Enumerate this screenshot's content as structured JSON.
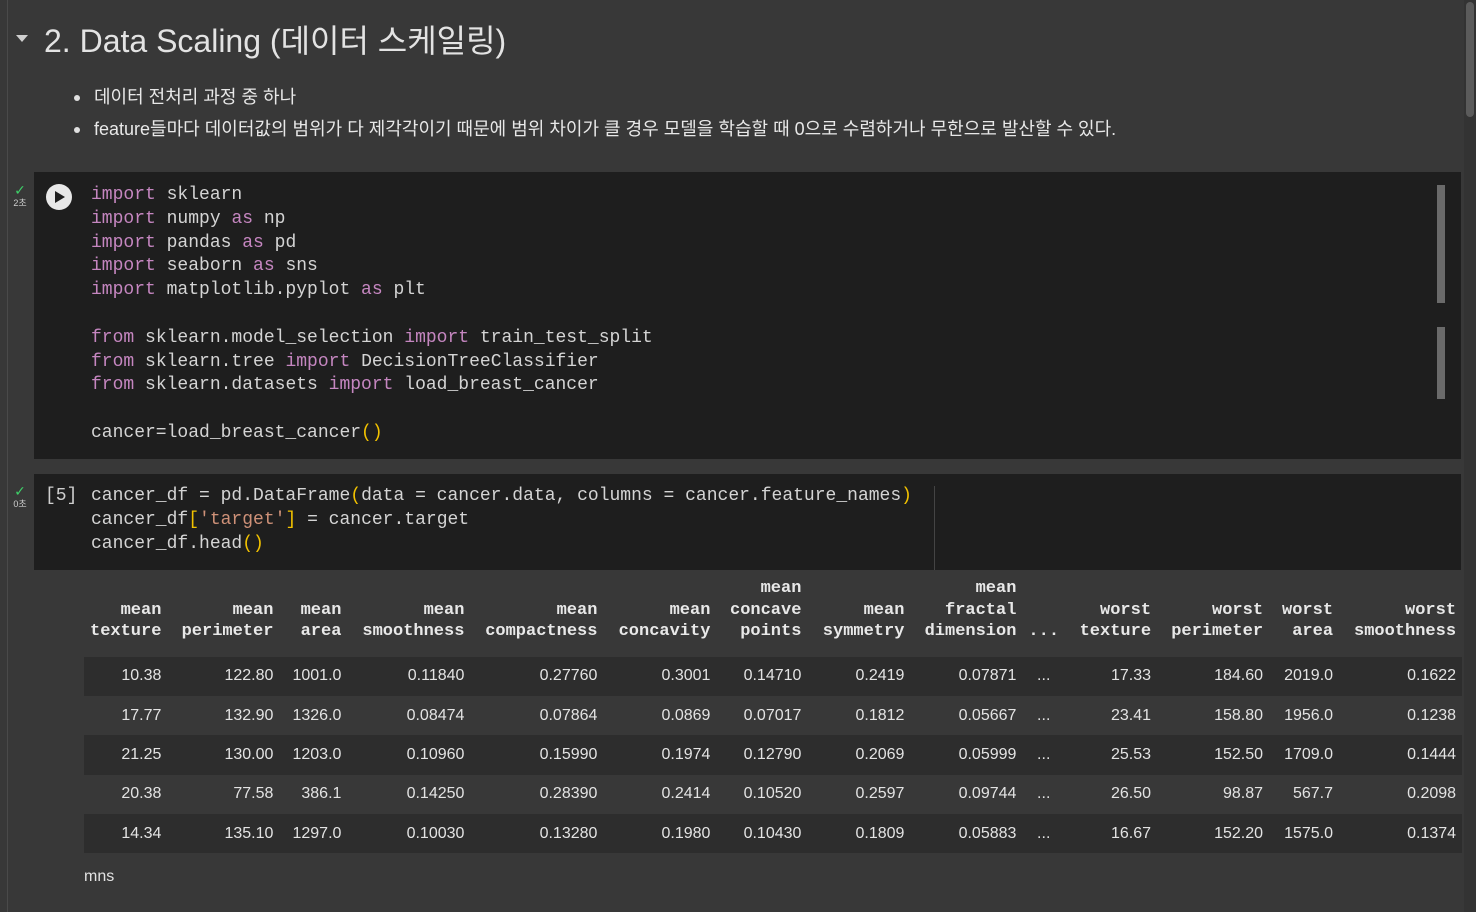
{
  "section": {
    "title": "2. Data Scaling (데이터 스케일링)",
    "bullets": [
      "데이터 전처리 과정 중 하나",
      "feature들마다 데이터값의 범위가 다 제각각이기 때문에 범위 차이가 클 경우 모델을 학습할 때 0으로 수렴하거나 무한으로 발산할 수 있다."
    ]
  },
  "cell1": {
    "status_check": "✓",
    "status_time": "2초"
  },
  "cell2": {
    "status_check": "✓",
    "status_time": "0초",
    "exec_count": "[5]"
  },
  "dataframe": {
    "columns": [
      [
        "mean",
        "texture"
      ],
      [
        "mean",
        "perimeter"
      ],
      [
        "mean",
        "area"
      ],
      [
        "mean",
        "smoothness"
      ],
      [
        "mean",
        "compactness"
      ],
      [
        "mean",
        "concavity"
      ],
      [
        "mean",
        "concave",
        "points"
      ],
      [
        "mean",
        "symmetry"
      ],
      [
        "mean",
        "fractal",
        "dimension"
      ],
      [
        "..."
      ],
      [
        "worst",
        "texture"
      ],
      [
        "worst",
        "perimeter"
      ],
      [
        "worst",
        "area"
      ],
      [
        "worst",
        "smoothness"
      ]
    ],
    "rows": [
      [
        "10.38",
        "122.80",
        "1001.0",
        "0.11840",
        "0.27760",
        "0.3001",
        "0.14710",
        "0.2419",
        "0.07871",
        "...",
        "17.33",
        "184.60",
        "2019.0",
        "0.1622"
      ],
      [
        "17.77",
        "132.90",
        "1326.0",
        "0.08474",
        "0.07864",
        "0.0869",
        "0.07017",
        "0.1812",
        "0.05667",
        "...",
        "23.41",
        "158.80",
        "1956.0",
        "0.1238"
      ],
      [
        "21.25",
        "130.00",
        "1203.0",
        "0.10960",
        "0.15990",
        "0.1974",
        "0.12790",
        "0.2069",
        "0.05999",
        "...",
        "25.53",
        "152.50",
        "1709.0",
        "0.1444"
      ],
      [
        "20.38",
        "77.58",
        "386.1",
        "0.14250",
        "0.28390",
        "0.2414",
        "0.10520",
        "0.2597",
        "0.09744",
        "...",
        "26.50",
        "98.87",
        "567.7",
        "0.2098"
      ],
      [
        "14.34",
        "135.10",
        "1297.0",
        "0.10030",
        "0.13280",
        "0.1980",
        "0.10430",
        "0.1809",
        "0.05883",
        "...",
        "16.67",
        "152.20",
        "1575.0",
        "0.1374"
      ]
    ],
    "footer": "mns"
  }
}
